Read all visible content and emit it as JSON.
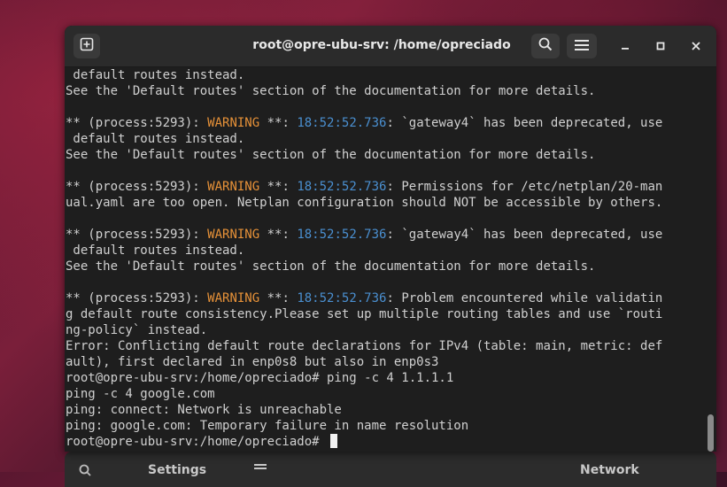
{
  "background_window": {
    "settings_title": "Settings",
    "network_title": "Network"
  },
  "terminal": {
    "title": "root@opre-ubu-srv: /home/opreciado",
    "lines": [
      [
        {
          "t": " default routes instead.",
          "c": ""
        }
      ],
      [
        {
          "t": "See the 'Default routes' section of the documentation for more details.",
          "c": ""
        }
      ],
      [
        {
          "t": "",
          "c": ""
        }
      ],
      [
        {
          "t": "** (process:5293): ",
          "c": ""
        },
        {
          "t": "WARNING",
          "c": "warn"
        },
        {
          "t": " **: ",
          "c": ""
        },
        {
          "t": "18:52:52.736",
          "c": "ts"
        },
        {
          "t": ": `gateway4` has been deprecated, use",
          "c": ""
        }
      ],
      [
        {
          "t": " default routes instead.",
          "c": ""
        }
      ],
      [
        {
          "t": "See the 'Default routes' section of the documentation for more details.",
          "c": ""
        }
      ],
      [
        {
          "t": "",
          "c": ""
        }
      ],
      [
        {
          "t": "** (process:5293): ",
          "c": ""
        },
        {
          "t": "WARNING",
          "c": "warn"
        },
        {
          "t": " **: ",
          "c": ""
        },
        {
          "t": "18:52:52.736",
          "c": "ts"
        },
        {
          "t": ": Permissions for /etc/netplan/20-man",
          "c": ""
        }
      ],
      [
        {
          "t": "ual.yaml are too open. Netplan configuration should NOT be accessible by others.",
          "c": ""
        }
      ],
      [
        {
          "t": "",
          "c": ""
        }
      ],
      [
        {
          "t": "** (process:5293): ",
          "c": ""
        },
        {
          "t": "WARNING",
          "c": "warn"
        },
        {
          "t": " **: ",
          "c": ""
        },
        {
          "t": "18:52:52.736",
          "c": "ts"
        },
        {
          "t": ": `gateway4` has been deprecated, use",
          "c": ""
        }
      ],
      [
        {
          "t": " default routes instead.",
          "c": ""
        }
      ],
      [
        {
          "t": "See the 'Default routes' section of the documentation for more details.",
          "c": ""
        }
      ],
      [
        {
          "t": "",
          "c": ""
        }
      ],
      [
        {
          "t": "** (process:5293): ",
          "c": ""
        },
        {
          "t": "WARNING",
          "c": "warn"
        },
        {
          "t": " **: ",
          "c": ""
        },
        {
          "t": "18:52:52.736",
          "c": "ts"
        },
        {
          "t": ": Problem encountered while validatin",
          "c": ""
        }
      ],
      [
        {
          "t": "g default route consistency.Please set up multiple routing tables and use `routi",
          "c": ""
        }
      ],
      [
        {
          "t": "ng-policy` instead.",
          "c": ""
        }
      ],
      [
        {
          "t": "Error: Conflicting default route declarations for IPv4 (table: main, metric: def",
          "c": ""
        }
      ],
      [
        {
          "t": "ault), first declared in enp0s8 but also in enp0s3",
          "c": ""
        }
      ],
      [
        {
          "t": "root@opre-ubu-srv:/home/opreciado# ping -c 4 1.1.1.1",
          "c": ""
        }
      ],
      [
        {
          "t": "ping -c 4 google.com",
          "c": ""
        }
      ],
      [
        {
          "t": "ping: connect: Network is unreachable",
          "c": ""
        }
      ],
      [
        {
          "t": "ping: google.com: Temporary failure in name resolution",
          "c": ""
        }
      ],
      [
        {
          "t": "root@opre-ubu-srv:/home/opreciado# ",
          "c": ""
        }
      ]
    ]
  },
  "icons": {
    "new_tab": "new-tab-icon",
    "search": "search-icon",
    "menu": "hamburger-menu-icon",
    "minimize": "minimize-icon",
    "maximize": "maximize-icon",
    "close": "close-icon"
  },
  "colors": {
    "warning": "#e69138",
    "timestamp": "#4a8fd0",
    "terminal_bg": "#1e1e1e",
    "text": "#d0d0d0"
  }
}
